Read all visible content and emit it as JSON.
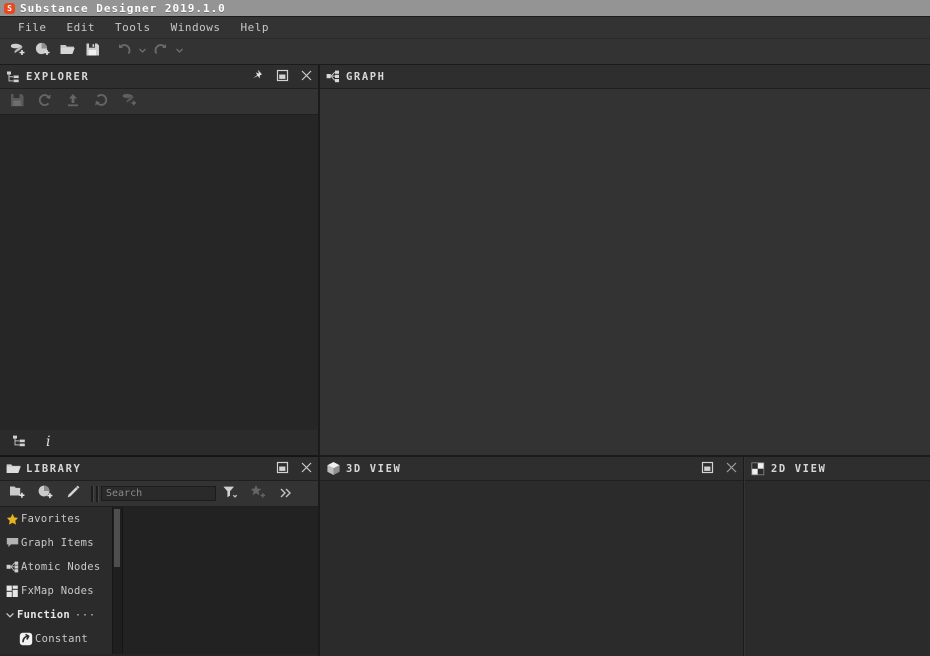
{
  "window": {
    "title": "Substance Designer 2019.1.0",
    "app_icon": "substance-logo-icon",
    "icon_letter": "S",
    "accent_color": "#e8491f",
    "titlebar_color": "#949494"
  },
  "menubar": {
    "items": [
      {
        "label": "File",
        "name": "menu-file"
      },
      {
        "label": "Edit",
        "name": "menu-edit"
      },
      {
        "label": "Tools",
        "name": "menu-tools"
      },
      {
        "label": "Windows",
        "name": "menu-windows"
      },
      {
        "label": "Help",
        "name": "menu-help"
      }
    ]
  },
  "toolbar": {
    "buttons": [
      {
        "name": "new-substance-graph-button",
        "icon": "new-substance-graph-icon",
        "enabled": true
      },
      {
        "name": "new-mdl-graph-button",
        "icon": "new-mdl-graph-icon",
        "enabled": true
      },
      {
        "name": "open-package-button",
        "icon": "open-folder-icon",
        "enabled": true
      },
      {
        "name": "save-package-button",
        "icon": "floppy-save-icon",
        "enabled": true
      },
      {
        "name": "undo-button",
        "icon": "undo-arrow-icon",
        "enabled": false
      },
      {
        "name": "undo-history-dropdown",
        "icon": "chevron-down-icon",
        "enabled": false
      },
      {
        "name": "redo-button",
        "icon": "redo-arrow-icon",
        "enabled": false
      },
      {
        "name": "redo-history-dropdown",
        "icon": "chevron-down-icon",
        "enabled": false
      }
    ]
  },
  "explorer": {
    "title": "EXPLORER",
    "icon": "hierarchy-tree-icon",
    "header_buttons": [
      {
        "name": "pin-panel-button",
        "icon": "pin-icon"
      },
      {
        "name": "float-panel-button",
        "icon": "float-window-icon"
      },
      {
        "name": "close-panel-button",
        "icon": "close-icon"
      }
    ],
    "toolbar_buttons": [
      {
        "name": "save-package-button",
        "icon": "floppy-save-icon",
        "enabled": false
      },
      {
        "name": "reload-package-button",
        "icon": "refresh-arrow-icon",
        "enabled": false
      },
      {
        "name": "export-package-button",
        "icon": "upload-arrow-icon",
        "enabled": false
      },
      {
        "name": "update-package-button",
        "icon": "sync-arrow-icon",
        "enabled": false
      },
      {
        "name": "link-package-button",
        "icon": "link-substance-icon",
        "enabled": false
      }
    ],
    "tabs": [
      {
        "name": "explorer-tab-tree",
        "icon": "hierarchy-tree-icon",
        "active": true
      },
      {
        "name": "explorer-tab-info",
        "icon": "info-italic-i-icon",
        "active": false
      }
    ],
    "items": []
  },
  "library": {
    "title": "LIBRARY",
    "icon": "open-folder-icon",
    "header_buttons": [
      {
        "name": "float-panel-button",
        "icon": "float-window-icon"
      },
      {
        "name": "close-panel-button",
        "icon": "close-icon"
      }
    ],
    "toolbar_buttons": [
      {
        "name": "new-library-folder-button",
        "icon": "new-folder-icon"
      },
      {
        "name": "new-library-item-button",
        "icon": "new-mdl-graph-icon"
      },
      {
        "name": "edit-library-button",
        "icon": "pencil-edit-icon"
      }
    ],
    "search": {
      "name": "library-search-input",
      "value": "",
      "placeholder": "Search"
    },
    "search_buttons": [
      {
        "name": "filter-button",
        "icon": "filter-funnel-icon"
      },
      {
        "name": "add-to-favorites-button",
        "icon": "star-plus-icon"
      },
      {
        "name": "more-options-button",
        "icon": "double-chevron-right-icon"
      }
    ],
    "tree": [
      {
        "name": "library-item-favorites",
        "label": "Favorites",
        "icon": "star-icon",
        "icon_color": "#e8b320",
        "depth": 0,
        "expandable": false,
        "bold": false,
        "dots": false
      },
      {
        "name": "library-item-graph-items",
        "label": "Graph Items",
        "icon": "speech-bubble-icon",
        "icon_color": "#b9b9b9",
        "depth": 0,
        "expandable": false,
        "bold": false,
        "dots": false
      },
      {
        "name": "library-item-atomic-nodes",
        "label": "Atomic Nodes",
        "icon": "graph-node-icon",
        "icon_color": "#cfcfcf",
        "depth": 0,
        "expandable": false,
        "bold": false,
        "dots": false
      },
      {
        "name": "library-item-fxmap-nodes",
        "label": "FxMap Nodes",
        "icon": "grid-squares-icon",
        "icon_color": "#e2e2e2",
        "depth": 0,
        "expandable": false,
        "bold": false,
        "dots": false
      },
      {
        "name": "library-item-function",
        "label": "Function",
        "icon": "",
        "icon_color": "#e6e6e6",
        "depth": 0,
        "expandable": true,
        "expanded": true,
        "bold": true,
        "dots": true,
        "dots_label": "···"
      },
      {
        "name": "library-item-constant",
        "label": "Constant",
        "icon": "constant-arrow-icon",
        "icon_color": "#ffffff",
        "depth": 1,
        "expandable": false,
        "bold": false,
        "dots": false
      }
    ]
  },
  "graph": {
    "title": "GRAPH",
    "icon": "graph-node-icon",
    "canvas_color": "#333333",
    "header_buttons": []
  },
  "view3d": {
    "title": "3D VIEW",
    "icon": "cube-3d-icon",
    "canvas_color": "#2b2b2b",
    "header_buttons": [
      {
        "name": "float-panel-button",
        "icon": "float-window-icon"
      },
      {
        "name": "close-panel-button",
        "icon": "close-icon"
      }
    ]
  },
  "view2d": {
    "title": "2D VIEW",
    "icon": "checkerboard-icon",
    "canvas_color": "#2b2b2b",
    "header_buttons": []
  }
}
